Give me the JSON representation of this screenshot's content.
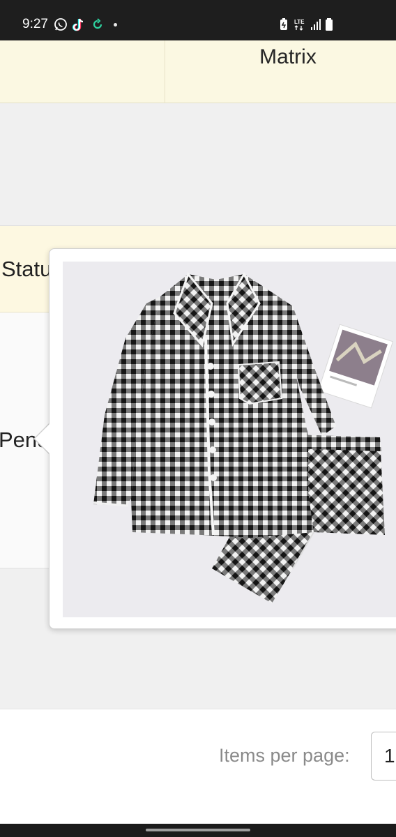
{
  "status_bar": {
    "time": "9:27",
    "left_icons": [
      "whatsapp-icon",
      "tiktok-icon",
      "sync-icon"
    ],
    "network": "LTE",
    "right_icons": [
      "battery-saver-icon",
      "lte-icon",
      "signal-icon",
      "battery-icon"
    ]
  },
  "table_top": {
    "column_header": "Matrix"
  },
  "table": {
    "status_header": "Status",
    "status_value": "Pending"
  },
  "popover": {
    "image_subject": "black-white-gingham-pajama-set",
    "image_colors": {
      "dark": "#151515",
      "light": "#f2f2f2",
      "background": "#ecebef"
    }
  },
  "footer": {
    "items_per_page_label": "Items per page:",
    "items_per_page_value": "1"
  },
  "colors": {
    "header_background": "#fbf8e2",
    "page_background": "#f0f0f0",
    "status_bar": "#1e1e1e"
  }
}
